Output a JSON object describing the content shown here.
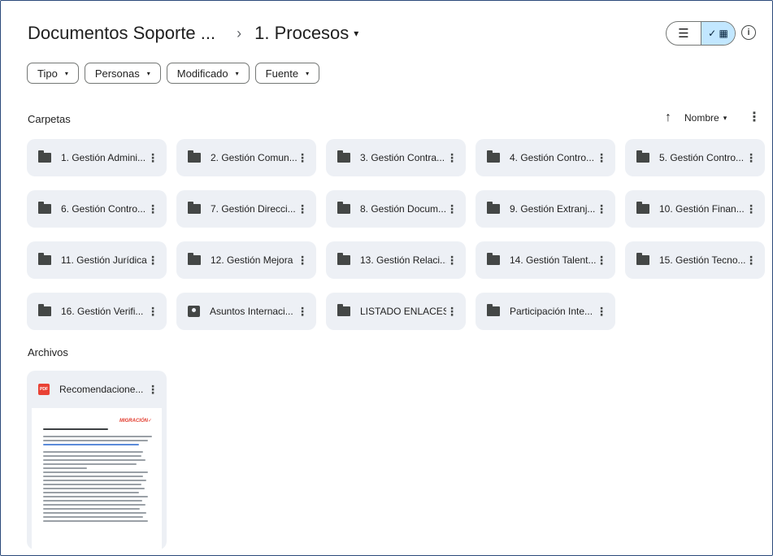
{
  "breadcrumb": {
    "root": "Documentos Soporte ...",
    "separator": "›",
    "current": "1. Procesos",
    "current_caret": "▾"
  },
  "view_toggle": {
    "list_icon": "list-icon",
    "list_glyph": "☰",
    "grid_icon": "grid-icon",
    "grid_glyph": "✓ ▦",
    "selected": "grid"
  },
  "info_glyph": "i",
  "filters": [
    {
      "label": "Tipo"
    },
    {
      "label": "Personas"
    },
    {
      "label": "Modificado"
    },
    {
      "label": "Fuente"
    }
  ],
  "filter_caret": "▾",
  "folders_section": {
    "title": "Carpetas",
    "sort_arrow": "↑",
    "sort_label": "Nombre",
    "sort_caret": "▾",
    "more_glyph": "⋮"
  },
  "folders": [
    {
      "name": "1. Gestión Admini...",
      "icon": "folder"
    },
    {
      "name": "2. Gestión Comun...",
      "icon": "folder"
    },
    {
      "name": "3. Gestión Contra...",
      "icon": "folder"
    },
    {
      "name": "4. Gestión Contro...",
      "icon": "folder"
    },
    {
      "name": "5. Gestión Contro...",
      "icon": "folder"
    },
    {
      "name": "6. Gestión Contro...",
      "icon": "folder"
    },
    {
      "name": "7. Gestión Direcci...",
      "icon": "folder"
    },
    {
      "name": "8. Gestión Docum...",
      "icon": "folder"
    },
    {
      "name": "9. Gestión Extranj...",
      "icon": "folder"
    },
    {
      "name": "10. Gestión Finan...",
      "icon": "folder"
    },
    {
      "name": "11. Gestión Jurídica",
      "icon": "folder"
    },
    {
      "name": "12. Gestión Mejora",
      "icon": "folder"
    },
    {
      "name": "13. Gestión Relaci...",
      "icon": "folder"
    },
    {
      "name": "14. Gestión Talent...",
      "icon": "folder"
    },
    {
      "name": "15. Gestión Tecno...",
      "icon": "folder"
    },
    {
      "name": "16. Gestión Verifi...",
      "icon": "folder"
    },
    {
      "name": "Asuntos Internaci...",
      "icon": "shared-folder"
    },
    {
      "name": "LISTADO ENLACES",
      "icon": "folder"
    },
    {
      "name": "Participación Inte...",
      "icon": "folder"
    }
  ],
  "files_section": {
    "title": "Archivos"
  },
  "files": [
    {
      "name": "Recomendacione...",
      "icon": "pdf",
      "icon_text": "PDF",
      "thumb_logo": "MIGRACIÓN",
      "thumb_logo_mark": "✓"
    }
  ],
  "colors": {
    "chip_bg": "#edf0f5",
    "toggle_selected": "#c2e7ff",
    "pdf_red": "#e94235",
    "frame_border": "#2b4a7a"
  }
}
